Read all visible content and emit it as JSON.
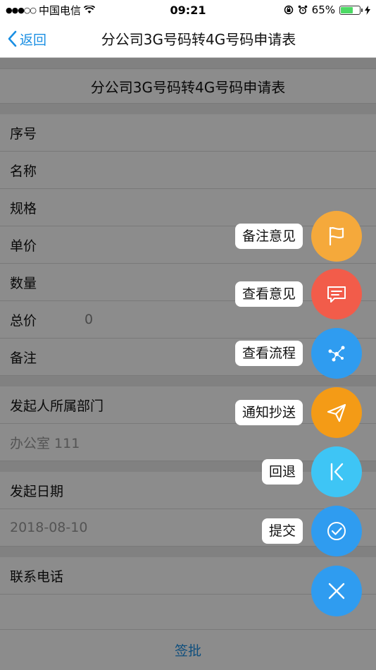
{
  "status": {
    "carrier": "中国电信",
    "time": "09:21",
    "battery": "65%",
    "battery_level": 0.65
  },
  "nav": {
    "back_label": "返回",
    "title": "分公司3G号码转4G号码申请表"
  },
  "form": {
    "title": "分公司3G号码转4G号码申请表",
    "fields": [
      {
        "label": "序号",
        "value": ""
      },
      {
        "label": "名称",
        "value": ""
      },
      {
        "label": "规格",
        "value": ""
      },
      {
        "label": "单价",
        "value": ""
      },
      {
        "label": "数量",
        "value": ""
      },
      {
        "label": "总价",
        "value": "0"
      },
      {
        "label": "备注",
        "value": ""
      }
    ],
    "dept_label": "发起人所属部门",
    "dept_value": "办公室 111",
    "date_label": "发起日期",
    "date_value": "2018-08-10",
    "phone_label": "联系电话"
  },
  "bottom": {
    "action_label": "签批"
  },
  "fab_menu": [
    {
      "label": "备注意见",
      "icon": "flag-icon",
      "color": "#f5a93b"
    },
    {
      "label": "查看意见",
      "icon": "message-icon",
      "color": "#f25c4a"
    },
    {
      "label": "查看流程",
      "icon": "flow-icon",
      "color": "#2f9cf0"
    },
    {
      "label": "通知抄送",
      "icon": "send-icon",
      "color": "#f49b16"
    },
    {
      "label": "回退",
      "icon": "rewind-icon",
      "color": "#3ec5f5"
    },
    {
      "label": "提交",
      "icon": "check-icon",
      "color": "#2f9cf0"
    }
  ],
  "fab_close": {
    "icon": "close-icon",
    "color": "#2f9cf0"
  }
}
